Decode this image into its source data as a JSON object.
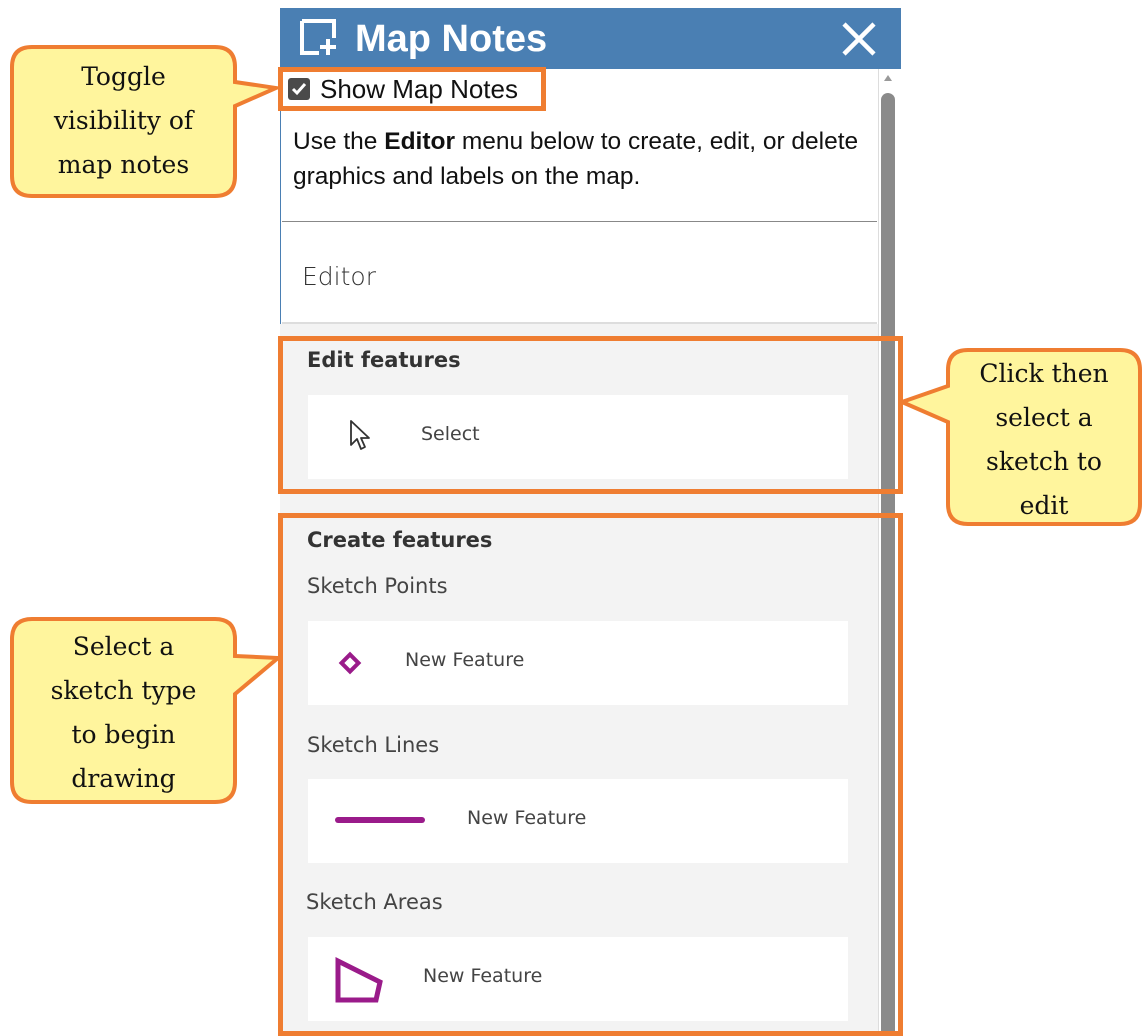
{
  "panel": {
    "title": "Map Notes",
    "title_icon": "add-note-icon",
    "close_icon": "close-icon",
    "show_checkbox": {
      "label": "Show Map Notes",
      "checked": true
    },
    "intro_pre": "Use the ",
    "intro_bold": "Editor",
    "intro_post": " menu below to create, edit, or delete graphics and labels on the map.",
    "editor_label": "Editor"
  },
  "edit_features": {
    "title": "Edit features",
    "select": {
      "icon": "pointer-icon",
      "label": "Select"
    }
  },
  "create_features": {
    "title": "Create features",
    "groups": [
      {
        "title": "Sketch Points",
        "icon": "diamond-point-icon",
        "label": "New Feature"
      },
      {
        "title": "Sketch Lines",
        "icon": "line-icon",
        "label": "New Feature"
      },
      {
        "title": "Sketch Areas",
        "icon": "polygon-icon",
        "label": "New Feature"
      }
    ]
  },
  "callouts": {
    "toggle": [
      "Toggle",
      "visibility of",
      "map notes"
    ],
    "edit": [
      "Click then",
      "select a",
      "sketch to",
      "edit"
    ],
    "create": [
      "Select a",
      "sketch type",
      "to begin",
      "drawing"
    ]
  },
  "colors": {
    "titlebar": "#4a7fb3",
    "highlight": "#ef7d31",
    "callout_fill": "#fff59d",
    "sketch": "#9a1b8a"
  }
}
